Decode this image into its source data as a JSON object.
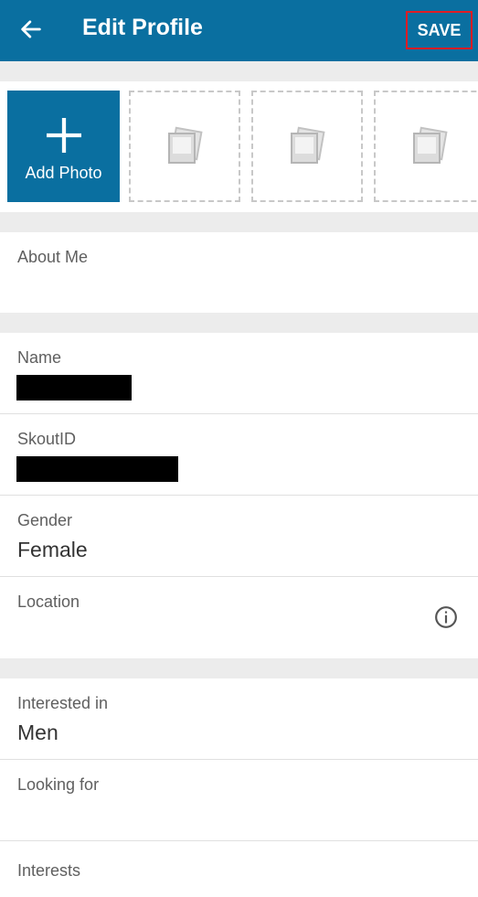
{
  "header": {
    "title": "Edit Profile",
    "save_label": "SAVE"
  },
  "photos": {
    "add_label": "Add Photo"
  },
  "fields": {
    "about_me": {
      "label": "About Me"
    },
    "name": {
      "label": "Name"
    },
    "skout_id": {
      "label": "SkoutID"
    },
    "gender": {
      "label": "Gender",
      "value": "Female"
    },
    "location": {
      "label": "Location"
    },
    "interested_in": {
      "label": "Interested in",
      "value": "Men"
    },
    "looking_for": {
      "label": "Looking for"
    },
    "interests": {
      "label": "Interests"
    }
  },
  "colors": {
    "primary": "#0a6fa0",
    "save_outline": "#e11c24"
  }
}
